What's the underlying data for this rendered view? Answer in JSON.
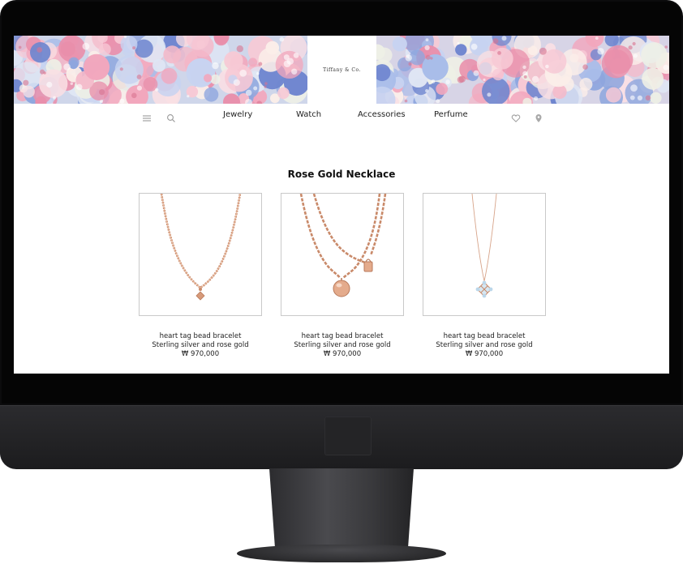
{
  "brand": {
    "logo": "Tiffany & Co."
  },
  "nav": {
    "icons": [
      "menu-icon",
      "search-icon",
      "heart-icon",
      "location-pin-icon"
    ],
    "items": [
      "Jewelry",
      "Watch",
      "Accessories",
      "Perfume"
    ]
  },
  "section": {
    "title": "Rose Gold Necklace"
  },
  "products": [
    {
      "name": "heart tag bead bracelet",
      "material": "Sterling silver and rose gold",
      "price": "₩ 970,000"
    },
    {
      "name": "heart tag bead bracelet",
      "material": "Sterling silver and rose gold",
      "price": "₩ 970,000"
    },
    {
      "name": "heart tag bead bracelet",
      "material": "Sterling silver and rose gold",
      "price": "₩ 970,000"
    }
  ],
  "colors": {
    "rose_gold": "#d79a7a",
    "text": "#222222",
    "card_border": "#c9c9c9",
    "monitor": "#0c0c0d"
  }
}
